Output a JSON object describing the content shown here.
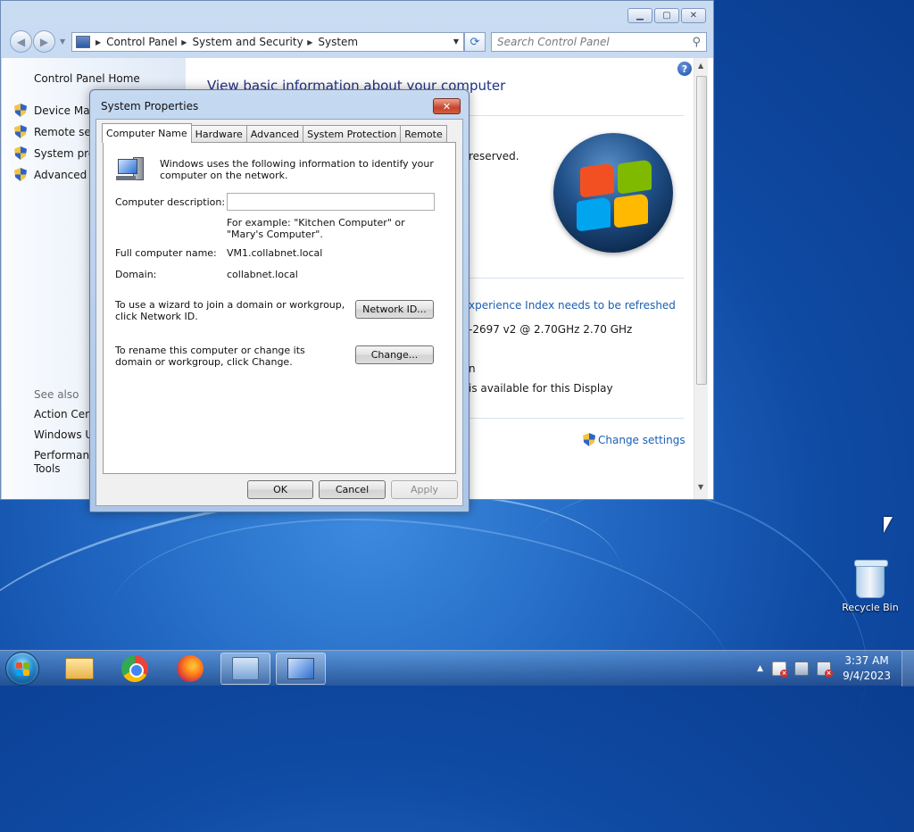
{
  "control_panel": {
    "address_crumbs": [
      "Control Panel",
      "System and Security",
      "System"
    ],
    "search_placeholder": "Search Control Panel",
    "sidebar": {
      "home": "Control Panel Home",
      "tasks": [
        "Device Man",
        "Remote sett",
        "System prot",
        "Advanced sy"
      ],
      "see_also_heading": "See also",
      "see_also": [
        "Action Cent",
        "Windows Up",
        "Performanc",
        "Tools"
      ]
    },
    "main": {
      "title": "View basic information about your computer",
      "reserved": "reserved.",
      "experience_link": "xperience Index needs to be refreshed",
      "processor": "-2697 v2 @ 2.70GHz   2.70 GHz",
      "pen_fragment": "n",
      "display_text": "is available for this Display",
      "change_settings": "Change settings"
    }
  },
  "dialog": {
    "title": "System Properties",
    "close": "✕",
    "tabs": [
      "Computer Name",
      "Hardware",
      "Advanced",
      "System Protection",
      "Remote"
    ],
    "active_tab": "Computer Name",
    "intro": "Windows uses the following information to identify your computer on the network.",
    "description_label": "Computer description:",
    "description_value": "",
    "example_text": "For example: \"Kitchen Computer\" or \"Mary's Computer\".",
    "full_name_label": "Full computer name:",
    "full_name_value": "VM1.collabnet.local",
    "domain_label": "Domain:",
    "domain_value": "collabnet.local",
    "network_id_text": "To use a wizard to join a domain or workgroup, click Network ID.",
    "network_id_button": "Network ID...",
    "rename_text": "To rename this computer or change its domain or workgroup, click Change.",
    "change_button": "Change...",
    "ok": "OK",
    "cancel": "Cancel",
    "apply": "Apply"
  },
  "desktop": {
    "recycle_bin": "Recycle Bin"
  },
  "taskbar": {
    "time": "3:37 AM",
    "date": "9/4/2023"
  }
}
